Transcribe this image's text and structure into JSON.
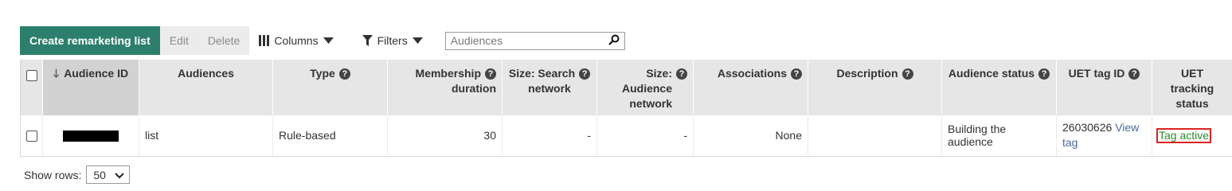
{
  "toolbar": {
    "create_label": "Create remarketing list",
    "edit_label": "Edit",
    "delete_label": "Delete",
    "columns_label": "Columns",
    "filters_label": "Filters",
    "search_placeholder": "Audiences"
  },
  "table": {
    "headers": {
      "audience_id": "Audience ID",
      "audiences": "Audiences",
      "type": "Type",
      "membership_line1": "Membership",
      "membership_line2": "duration",
      "size_search_line1": "Size: Search",
      "size_search_line2": "network",
      "size_aud_line1": "Size:",
      "size_aud_line2": "Audience",
      "size_aud_line3": "network",
      "associations": "Associations",
      "description": "Description",
      "audience_status": "Audience status",
      "uet_tag_id": "UET tag ID",
      "uet_tracking_line1": "UET tracking",
      "uet_tracking_line2": "status"
    },
    "rows": [
      {
        "audience_id": "",
        "audiences": "list",
        "type": "Rule-based",
        "membership_duration": "30",
        "size_search": "-",
        "size_audience": "-",
        "associations": "None",
        "description": "",
        "audience_status": "Building the audience",
        "uet_tag_id": "26030626",
        "view_tag": "View tag",
        "uet_tracking_status": "Tag active"
      }
    ]
  },
  "footer": {
    "show_rows_label": "Show rows:",
    "rows_value": "50"
  },
  "colors": {
    "primary_button": "#2b7f6c",
    "status_red": "#b32546",
    "link": "#46699a",
    "tag_active_green": "#2e8b2e",
    "highlight_border": "#dd2222"
  }
}
